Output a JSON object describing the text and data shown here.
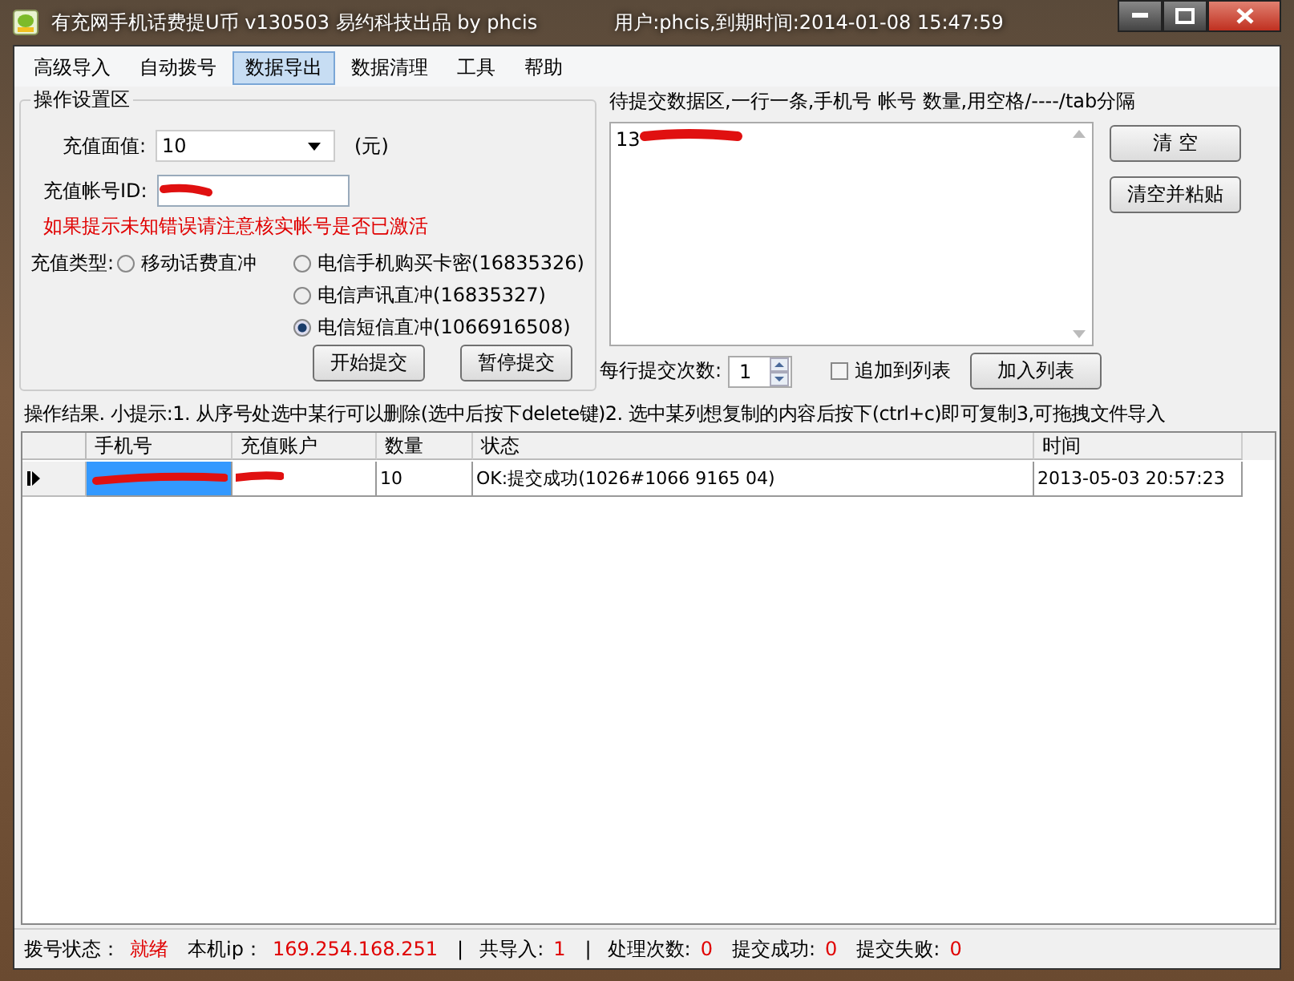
{
  "window": {
    "title": "有充网手机话费提U币  v130503 易约科技出品  by phcis",
    "user_info": "用户:phcis,到期时间:2014-01-08 15:47:59"
  },
  "menu": [
    {
      "label": "高级导入",
      "selected": false
    },
    {
      "label": "自动拨号",
      "selected": false
    },
    {
      "label": "数据导出",
      "selected": true
    },
    {
      "label": "数据清理",
      "selected": false
    },
    {
      "label": "工具",
      "selected": false
    },
    {
      "label": "帮助",
      "selected": false
    }
  ],
  "settings": {
    "title": "操作设置区",
    "amount_label": "充值面值:",
    "amount_value": "10",
    "amount_unit": "(元)",
    "account_label": "充值帐号ID:",
    "warning": "如果提示未知错误请注意核实帐号是否已激活",
    "type_label": "充值类型:",
    "types": [
      {
        "label": "移动话费直冲",
        "selected": false
      },
      {
        "label": "电信手机购买卡密(16835326)",
        "selected": false
      },
      {
        "label": "电信声讯直冲(16835327)",
        "selected": false
      },
      {
        "label": "电信短信直冲(1066916508)",
        "selected": true
      }
    ],
    "buttons": [
      "开始提交",
      "暂停提交"
    ]
  },
  "input_area": {
    "title": "待提交数据区,一行一条,手机号 帐号 数量,用空格/----/tab分隔",
    "text": "13",
    "side_buttons": [
      "清  空",
      "清空并粘贴"
    ],
    "per_row_label": "每行提交次数:",
    "per_row_value": "1",
    "append_label": "追加到列表",
    "append_checked": false,
    "add_button": "加入列表"
  },
  "hint": "操作结果. 小提示:1. 从序号处选中某行可以删除(选中后按下delete键)2. 选中某列想复制的内容后按下(ctrl+c)即可复制3,可拖拽文件导入",
  "table": {
    "columns": [
      "手机号",
      "充值账户",
      "数量",
      "状态",
      "时间"
    ],
    "rows": [
      {
        "selected": true,
        "quantity": "10",
        "status": "OK:提交成功(1026#1066 9165 04)",
        "time": "2013-05-03 20:57:23"
      }
    ]
  },
  "status_bar": [
    {
      "kind": "field",
      "label": "拨号状态：",
      "value": "就绪"
    },
    {
      "kind": "field",
      "label": "本机ip：",
      "value": "169.254.168.251"
    },
    {
      "kind": "separator",
      "label": "|"
    },
    {
      "kind": "field",
      "label": "共导入:",
      "value": "1"
    },
    {
      "kind": "separator",
      "label": "|"
    },
    {
      "kind": "field",
      "label": "处理次数:",
      "value": "0"
    },
    {
      "kind": "field",
      "label": "提交成功:",
      "value": "0"
    },
    {
      "kind": "field",
      "label": "提交失败:",
      "value": "0"
    }
  ]
}
